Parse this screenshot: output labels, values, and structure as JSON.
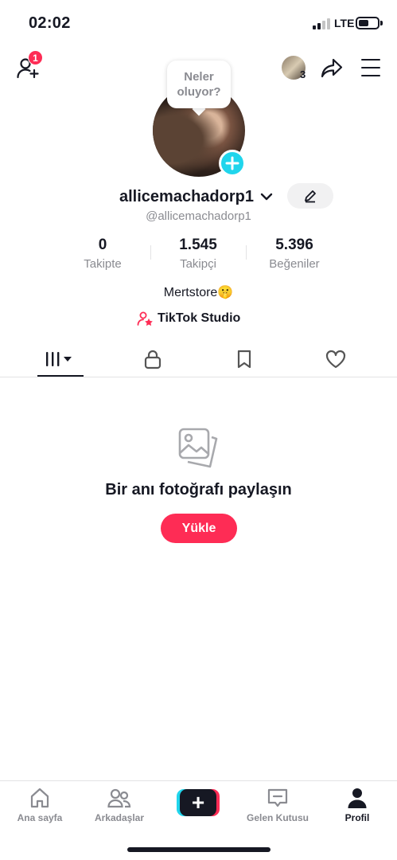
{
  "status_bar": {
    "time": "02:02",
    "network": "LTE",
    "battery_level": 0.55
  },
  "header": {
    "notification_count": "1",
    "story_count": "3",
    "icons": [
      "add-friend-icon",
      "story-avatar",
      "share-icon",
      "menu-icon"
    ]
  },
  "profile": {
    "speech_bubble_line1": "Neler",
    "speech_bubble_line2": "oluyor?",
    "username": "allicemachadorp1",
    "handle": "@allicemachadorp1",
    "bio": "Mertstore🤫",
    "studio_label": "TikTok Studio"
  },
  "stats": [
    {
      "value": "0",
      "label": "Takipte"
    },
    {
      "value": "1.545",
      "label": "Takipçi"
    },
    {
      "value": "5.396",
      "label": "Beğeniler"
    }
  ],
  "tabs": [
    "grid-icon",
    "lock-icon",
    "bookmark-icon",
    "heart-icon"
  ],
  "empty_state": {
    "title": "Bir anı fotoğrafı paylaşın",
    "button": "Yükle"
  },
  "bottom_nav": [
    {
      "label": "Ana sayfa",
      "icon": "home-icon"
    },
    {
      "label": "Arkadaşlar",
      "icon": "friends-icon"
    },
    {
      "label": "",
      "icon": "plus-icon"
    },
    {
      "label": "Gelen Kutusu",
      "icon": "inbox-icon"
    },
    {
      "label": "Profil",
      "icon": "profile-icon",
      "active": true
    }
  ],
  "colors": {
    "accent": "#fe2c55",
    "cyan": "#20d5ec",
    "text": "#161823",
    "muted": "#8a8b91"
  }
}
